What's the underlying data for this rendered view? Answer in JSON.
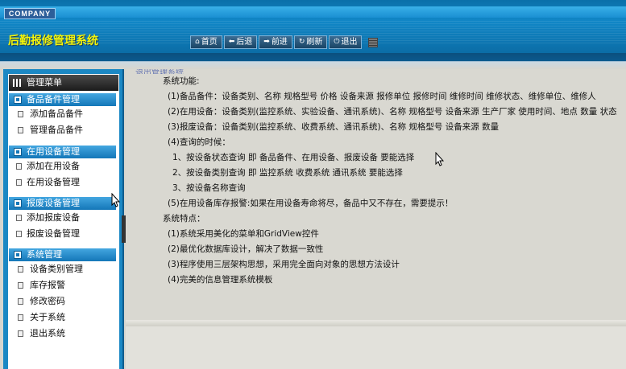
{
  "header": {
    "logo_text": "COMPANY",
    "app_title": "后勤报修管理系统",
    "toolbar": [
      {
        "label": "首页",
        "icon": "home-icon",
        "glyph": "⌂"
      },
      {
        "label": "后退",
        "icon": "back-arrow-icon",
        "glyph": "⬅"
      },
      {
        "label": "前进",
        "icon": "forward-arrow-icon",
        "glyph": "➡"
      },
      {
        "label": "刷新",
        "icon": "refresh-icon",
        "glyph": "↻"
      },
      {
        "label": "退出",
        "icon": "power-icon",
        "glyph": "⏻"
      }
    ]
  },
  "sidebar": {
    "menu_title": "管理菜单",
    "groups": [
      {
        "title": "备品备件管理",
        "items": [
          "添加备品备件",
          "管理备品备件"
        ]
      },
      {
        "title": "在用设备管理",
        "items": [
          "添加在用设备",
          "在用设备管理"
        ]
      },
      {
        "title": "报废设备管理",
        "items": [
          "添加报废设备",
          "报废设备管理"
        ]
      },
      {
        "title": "系统管理",
        "items": [
          "设备类别管理",
          "库存报警",
          "修改密码",
          "关于系统",
          "退出系统"
        ]
      }
    ]
  },
  "main": {
    "breadcrumb": "退出管理系统",
    "lines": [
      "系统功能:",
      "(1)备品备件：设备类别、名称 规格型号 价格 设备来源 报修单位 报修时间 维修时间 维修状态、维修单位、维修人",
      "(2)在用设备：设备类别(监控系统、实验设备、通讯系统)、名称 规格型号 设备来源 生产厂家 使用时间、地点 数量 状态",
      "(3)报废设备：设备类别(监控系统、收费系统、通讯系统)、名称 规格型号 设备来源 数量",
      "(4)查询的时候：",
      "1、按设备状态查询 即 备品备件、在用设备、报废设备 要能选择",
      "2、按设备类别查询 即 监控系统 收费系统 通讯系统 要能选择",
      "3、按设备名称查询",
      "(5)在用设备库存报警:如果在用设备寿命将尽，备品中又不存在，需要提示！",
      "系统特点：",
      "(1)系统采用美化的菜单和GridView控件",
      "(2)最优化数据库设计，解决了数据一致性",
      "(3)程序使用三层架构思想，采用完全面向对象的思想方法设计",
      "(4)完美的信息管理系统模板"
    ]
  }
}
